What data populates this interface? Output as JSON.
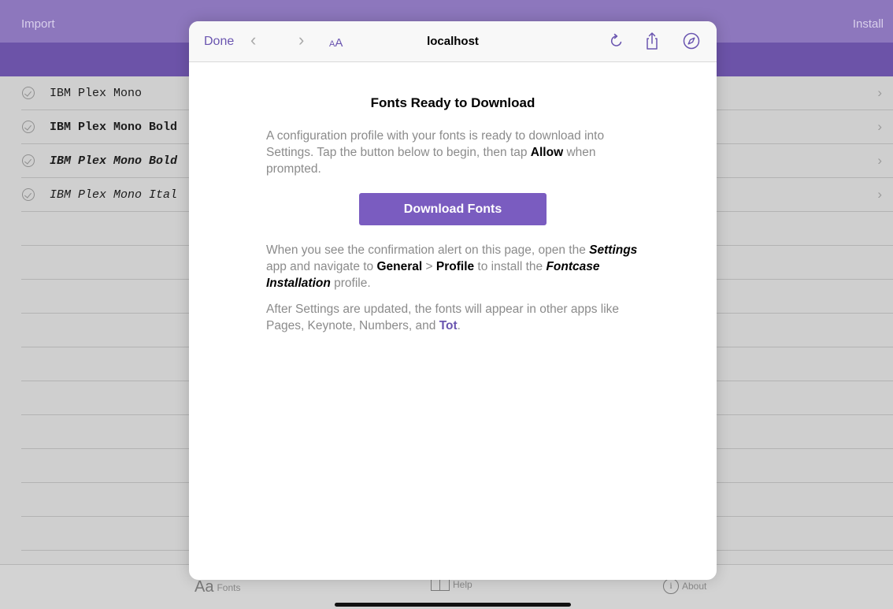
{
  "app": {
    "import_label": "Import",
    "install_label": "Install",
    "fonts": [
      {
        "name": "IBM Plex Mono",
        "style": "regular"
      },
      {
        "name": "IBM Plex Mono Bold",
        "style": "bold"
      },
      {
        "name": "IBM Plex Mono Bold",
        "style": "bold-italic"
      },
      {
        "name": "IBM Plex Mono Ital",
        "style": "italic"
      }
    ],
    "tabs": {
      "fonts_icon": "Aa",
      "fonts_label": "Fonts",
      "help_label": "Help",
      "about_icon": "i",
      "about_label": "About"
    }
  },
  "browser": {
    "done_label": "Done",
    "back_icon": "‹",
    "forward_icon": "›",
    "text_size_small": "A",
    "text_size_large": "A",
    "host": "localhost",
    "icons": [
      "reload-icon",
      "share-icon",
      "compass-icon"
    ]
  },
  "page": {
    "heading": "Fonts Ready to Download",
    "intro": {
      "p1": "A configuration profile with your fonts is ready to download into Settings. Tap the button below to begin, then tap ",
      "allow": "Allow",
      "p2": " when prompted."
    },
    "button_label": "Download Fonts",
    "instructions": {
      "t1": "When you see the confirmation alert on this page, open the ",
      "settings": "Settings",
      "t2": " app and navigate to ",
      "general": "General",
      "t3": " > ",
      "profile": "Profile",
      "t4": " to install the ",
      "fontcase": "Fontcase Installation",
      "t5": " profile."
    },
    "after": {
      "t1": "After Settings are updated, the fonts will appear in other apps like Pages, Keynote, Numbers, and ",
      "tot": "Tot",
      "t2": "."
    }
  },
  "colors": {
    "accent": "#6a55b0",
    "button": "#7a5cc0",
    "nav_bar": "#6c53a8"
  }
}
